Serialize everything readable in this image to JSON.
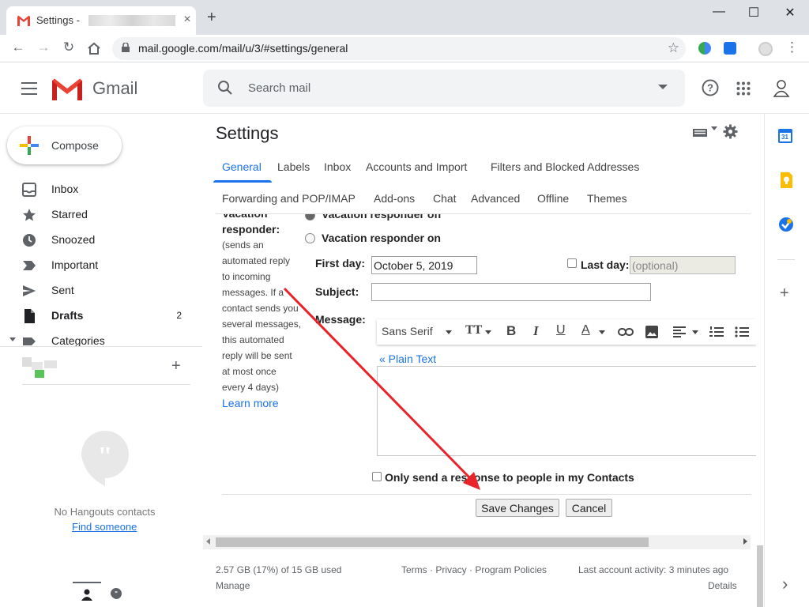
{
  "browser": {
    "tab_title": "Settings -",
    "tab_close": "×",
    "new_tab": "+",
    "window_controls": {
      "minimize": "—",
      "maximize": "☐",
      "close": "✕"
    },
    "url": "mail.google.com/mail/u/3/#settings/general"
  },
  "header": {
    "app_name": "Gmail",
    "search_placeholder": "Search mail"
  },
  "sidebar": {
    "compose_label": "Compose",
    "items": [
      {
        "label": "Inbox",
        "icon": "inbox-icon",
        "count": ""
      },
      {
        "label": "Starred",
        "icon": "star-icon",
        "count": ""
      },
      {
        "label": "Snoozed",
        "icon": "clock-icon",
        "count": ""
      },
      {
        "label": "Important",
        "icon": "important-icon",
        "count": ""
      },
      {
        "label": "Sent",
        "icon": "send-icon",
        "count": ""
      },
      {
        "label": "Drafts",
        "icon": "draft-icon",
        "count": "2"
      },
      {
        "label": "Categories",
        "icon": "label-icon",
        "count": ""
      }
    ],
    "hangouts": {
      "add": "+",
      "empty_text": "No Hangouts contacts",
      "find_link": "Find someone"
    }
  },
  "settings": {
    "title": "Settings",
    "tabs_row1": [
      "General",
      "Labels",
      "Inbox",
      "Accounts and Import",
      "Filters and Blocked Addresses"
    ],
    "tabs_row2": [
      "Forwarding and POP/IMAP",
      "Add-ons",
      "Chat",
      "Advanced",
      "Offline",
      "Themes"
    ],
    "active_tab": "General",
    "vacation": {
      "heading_cut": "Vacation",
      "heading": "responder:",
      "description": [
        "(sends an",
        "automated reply",
        "to incoming",
        "messages. If a",
        "contact sends you",
        "several messages,",
        "this automated",
        "reply will be sent",
        "at most once",
        "every 4 days)"
      ],
      "learn_more": "Learn more",
      "option_off": "Vacation responder off",
      "option_on": "Vacation responder on",
      "first_day_label": "First day:",
      "first_day_value": "October 5, 2019",
      "last_day_label": "Last day:",
      "last_day_placeholder": "(optional)",
      "subject_label": "Subject:",
      "subject_value": "",
      "message_label": "Message:",
      "font_name": "Sans Serif",
      "plain_text_link": "« Plain Text",
      "contacts_only_label": "Only send a response to people in my Contacts"
    },
    "save_button": "Save Changes",
    "cancel_button": "Cancel"
  },
  "footer": {
    "storage": "2.57 GB (17%) of 15 GB used",
    "manage": "Manage",
    "links": "Terms · Privacy · Program Policies",
    "last_activity": "Last account activity: 3 minutes ago",
    "details": "Details"
  },
  "side_panel": {
    "calendar_day": "31",
    "add": "+",
    "expand": "›"
  },
  "colors": {
    "accent": "#1a73e8",
    "annotation_arrow": "#e8232a",
    "gmail_red": "#ea4335"
  }
}
